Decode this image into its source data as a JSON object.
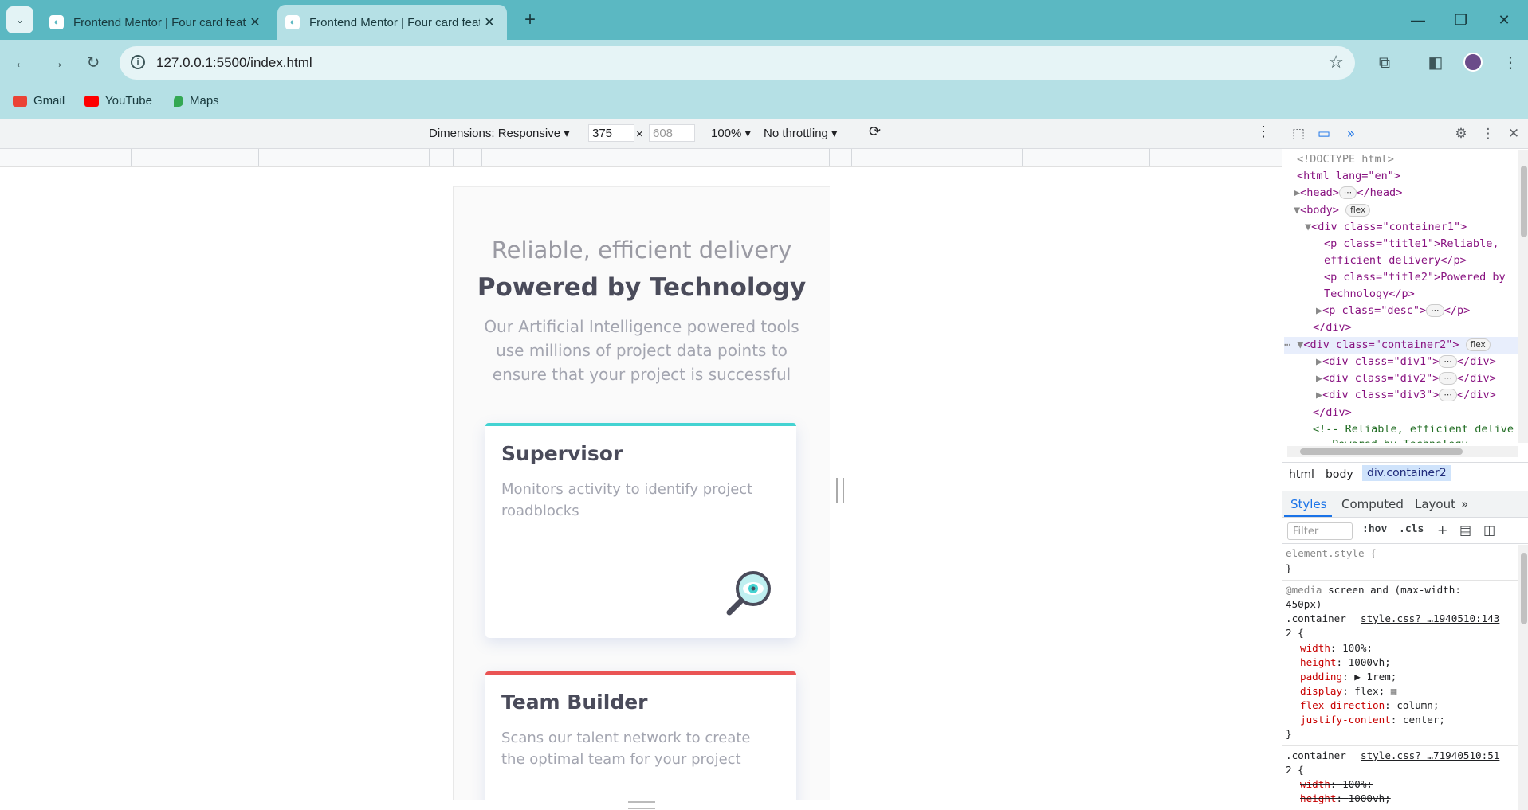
{
  "browser": {
    "tabs": [
      {
        "title": "Frontend Mentor | Four card feature section"
      },
      {
        "title": "Frontend Mentor | Four card feature section"
      }
    ],
    "url": "127.0.0.1:5500/index.html",
    "bookmarks": [
      {
        "label": "Gmail",
        "icon": "gmail-icon",
        "color": "#ea4335"
      },
      {
        "label": "YouTube",
        "icon": "youtube-icon",
        "color": "#ff0000"
      },
      {
        "label": "Maps",
        "icon": "maps-icon",
        "color": "#34a853"
      }
    ]
  },
  "device_toolbar": {
    "dimensions_label": "Dimensions: Responsive",
    "width": "375",
    "times": "×",
    "height": "608",
    "zoom": "100%",
    "throttling": "No throttling"
  },
  "page": {
    "hero_light": "Reliable, efficient delivery",
    "hero_bold": "Powered by Technology",
    "hero_desc": "Our Artificial Intelligence powered tools use millions of project data points to ensure that your project is successful",
    "cards": [
      {
        "title": "Supervisor",
        "desc": "Monitors activity to identify project roadblocks",
        "accent": "#44d3d2",
        "icon": "supervisor-magnifier-icon"
      },
      {
        "title": "Team Builder",
        "desc": "Scans our talent network to create the optimal team for your project",
        "accent": "#ea5454"
      }
    ]
  },
  "devtools": {
    "dom_lines": {
      "doctype": "<!DOCTYPE html>",
      "html_open": "<html lang=\"en\">",
      "head": "<head>",
      "head_close": "</head>",
      "body": "<body>",
      "flex_badge": "flex",
      "container1": "<div class=\"container1\">",
      "title1_a": "<p class=\"title1\">Reliable,",
      "title1_b": "efficient delivery</p>",
      "title2_a": "<p class=\"title2\">Powered by",
      "title2_b": "Technology</p>",
      "desc": "<p class=\"desc\">",
      "desc_close": "</p>",
      "div_close": "</div>",
      "container2": "<div class=\"container2\">",
      "div1": "<div class=\"div1\">",
      "div2": "<div class=\"div2\">",
      "div3": "<div class=\"div3\">",
      "div_child_close": "</div>",
      "container2_close": "</div>",
      "comment": "<!-- Reliable, efficient delive",
      "comment2": "Powered by Technology"
    },
    "breadcrumbs": [
      "html",
      "body",
      "div.container2"
    ],
    "tabs": [
      "Styles",
      "Computed",
      "Layout"
    ],
    "filter_placeholder": "Filter",
    "filter_buttons": [
      ":hov",
      ".cls"
    ],
    "styles": {
      "element_style": "element.style {",
      "close": "}",
      "media": "@media screen and (max-width:",
      "media2": "450px)",
      "rule1_selector": ".container",
      "rule1_source": "style.css?_…1940510:143",
      "rule1_line": "2 {",
      "rule1_props": [
        {
          "name": "width",
          "value": "100%;"
        },
        {
          "name": "height",
          "value": "1000vh;"
        },
        {
          "name": "padding",
          "value": "▶ 1rem;"
        },
        {
          "name": "display",
          "value": "flex;"
        },
        {
          "name": "flex-direction",
          "value": "column;"
        },
        {
          "name": "justify-content",
          "value": "center;"
        }
      ],
      "rule2_selector": ".container",
      "rule2_source": "style.css?_…71940510:51",
      "rule2_line": "2 {",
      "rule2_props": [
        {
          "name": "width",
          "value": "100%;"
        },
        {
          "name": "height",
          "value": "1000vh;"
        }
      ]
    }
  }
}
